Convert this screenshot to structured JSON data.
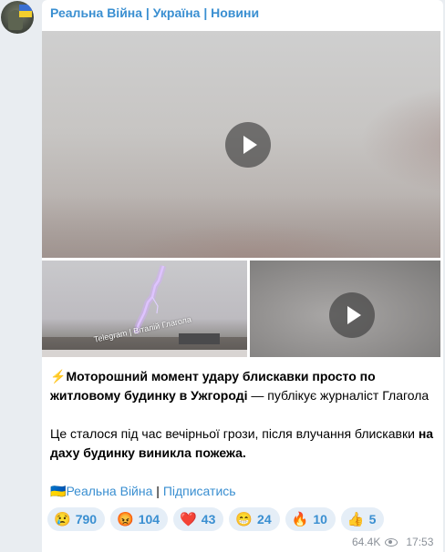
{
  "channel": {
    "name": "Реальна Війна | Україна | Новини"
  },
  "media": {
    "watermark": "Telegram | Віталій Глагола"
  },
  "post": {
    "p1_emoji": "⚡",
    "p1_bold": "Моторошний момент удару блискавки просто по житловому будинку в Ужгороді",
    "p1_rest": " — публікує журналіст Глагола",
    "p2_normal": "Це сталося під час вечірньої грози, після влучання блискавки ",
    "p2_bold": "на даху будинку виникла пожежа.",
    "footer_flag": "🇺🇦",
    "footer_link": "Реальна Війна",
    "footer_sep": " | ",
    "footer_subscribe": "Підписатись"
  },
  "reactions": [
    {
      "emoji": "😢",
      "count": "790"
    },
    {
      "emoji": "😡",
      "count": "104"
    },
    {
      "emoji": "❤️",
      "count": "43"
    },
    {
      "emoji": "😁",
      "count": "24"
    },
    {
      "emoji": "🔥",
      "count": "10"
    },
    {
      "emoji": "👍",
      "count": "5"
    }
  ],
  "meta": {
    "views": "64.4K",
    "time": "17:53"
  }
}
